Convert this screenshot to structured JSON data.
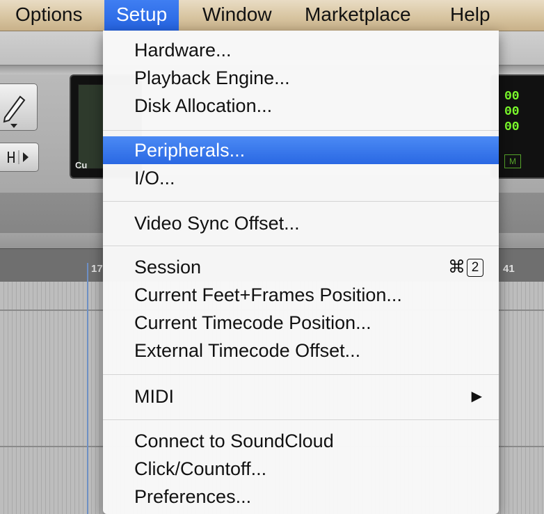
{
  "menubar": {
    "items": [
      {
        "label": "Options"
      },
      {
        "label": "Setup",
        "active": true
      },
      {
        "label": "Window"
      },
      {
        "label": "Marketplace"
      },
      {
        "label": "Help"
      }
    ]
  },
  "menu": {
    "items": [
      {
        "label": "Hardware..."
      },
      {
        "label": "Playback Engine..."
      },
      {
        "label": "Disk Allocation..."
      },
      {
        "label": "Peripherals...",
        "highlighted": true
      },
      {
        "label": "I/O..."
      },
      {
        "label": "Video Sync Offset..."
      },
      {
        "label": "Session",
        "shortcut_symbol": "⌘",
        "shortcut_key": "2"
      },
      {
        "label": "Current Feet+Frames Position..."
      },
      {
        "label": "Current Timecode Position..."
      },
      {
        "label": "External Timecode Offset..."
      },
      {
        "label": "MIDI",
        "submenu_arrow": "▶"
      },
      {
        "label": "Connect to SoundCloud"
      },
      {
        "label": "Click/Countoff..."
      },
      {
        "label": "Preferences..."
      }
    ]
  },
  "background": {
    "counter_label": "Cu",
    "counter_digits": [
      "00",
      "00",
      "00"
    ],
    "meter_box": "M",
    "ruler": [
      "17",
      "41"
    ]
  },
  "colors": {
    "highlight": "#2a68e3",
    "menubar_active": "#2563e0",
    "counter_green": "#7cff2c"
  }
}
